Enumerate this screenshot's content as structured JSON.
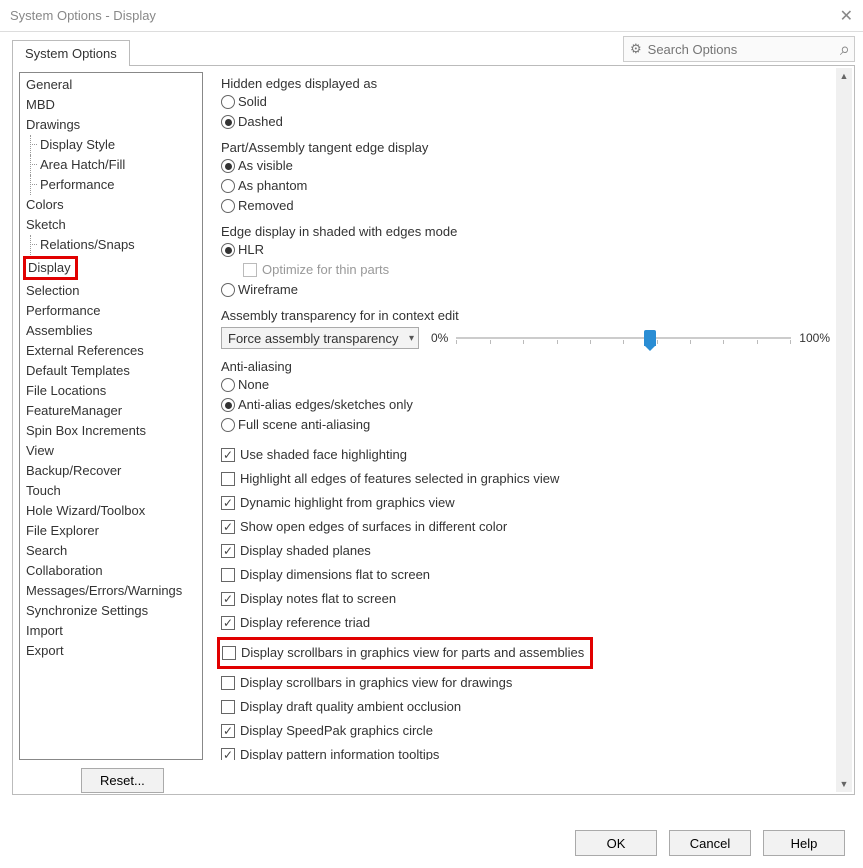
{
  "window": {
    "title": "System Options - Display"
  },
  "search": {
    "placeholder": "Search Options"
  },
  "tabs": {
    "main": "System Options"
  },
  "sidebar": {
    "items": [
      "General",
      "MBD",
      "Drawings",
      "Display Style",
      "Area Hatch/Fill",
      "Performance",
      "Colors",
      "Sketch",
      "Relations/Snaps",
      "Display",
      "Selection",
      "Performance",
      "Assemblies",
      "External References",
      "Default Templates",
      "File Locations",
      "FeatureManager",
      "Spin Box Increments",
      "View",
      "Backup/Recover",
      "Touch",
      "Hole Wizard/Toolbox",
      "File Explorer",
      "Search",
      "Collaboration",
      "Messages/Errors/Warnings",
      "Synchronize Settings",
      "Import",
      "Export"
    ]
  },
  "buttons": {
    "reset": "Reset...",
    "ok": "OK",
    "cancel": "Cancel",
    "help": "Help"
  },
  "groups": {
    "hiddenEdges": {
      "label": "Hidden edges displayed as",
      "opts": [
        "Solid",
        "Dashed"
      ],
      "selected": 1
    },
    "tangent": {
      "label": "Part/Assembly tangent edge display",
      "opts": [
        "As visible",
        "As phantom",
        "Removed"
      ],
      "selected": 0
    },
    "edgeShaded": {
      "label": "Edge display in shaded with edges mode",
      "opts": [
        "HLR",
        "Wireframe"
      ],
      "optimize": "Optimize for thin parts",
      "selected": 0
    },
    "assembly": {
      "label": "Assembly transparency for in context edit",
      "combo": "Force assembly transparency",
      "min": "0%",
      "max": "100%",
      "value": 56
    },
    "antialias": {
      "label": "Anti-aliasing",
      "opts": [
        "None",
        "Anti-alias edges/sketches only",
        "Full scene anti-aliasing"
      ],
      "selected": 1
    }
  },
  "checks": [
    {
      "label": "Use shaded face highlighting",
      "checked": true
    },
    {
      "label": "Highlight all edges of features selected in graphics view",
      "checked": false
    },
    {
      "label": "Dynamic highlight from graphics view",
      "checked": true
    },
    {
      "label": "Show open edges of surfaces in different color",
      "checked": true
    },
    {
      "label": "Display shaded planes",
      "checked": true
    },
    {
      "label": "Display dimensions flat to screen",
      "checked": false
    },
    {
      "label": "Display notes flat to screen",
      "checked": true
    },
    {
      "label": "Display reference triad",
      "checked": true
    },
    {
      "label": "Display scrollbars in graphics view for parts and assemblies",
      "checked": false,
      "highlight": true
    },
    {
      "label": "Display scrollbars in graphics view for drawings",
      "checked": false
    },
    {
      "label": "Display draft quality ambient occlusion",
      "checked": false
    },
    {
      "label": "Display SpeedPak graphics circle",
      "checked": true
    },
    {
      "label": "Display pattern information tooltips",
      "checked": true
    }
  ]
}
